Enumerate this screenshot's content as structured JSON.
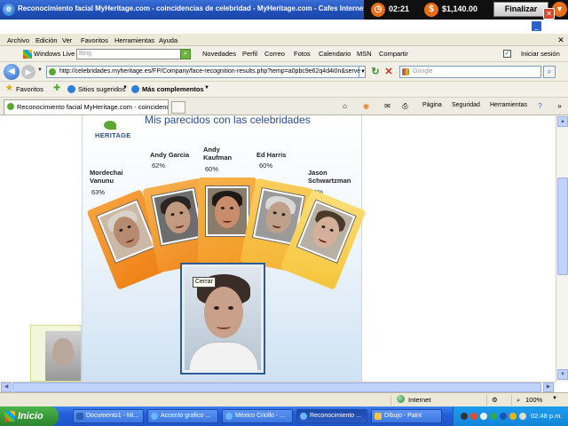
{
  "window": {
    "title": "Reconocimiento facial MyHeritage.com - coincidencias de celebridad - MyHeritage.com - Cafes Internet EL RETO tu mejor experienc"
  },
  "timer": {
    "time": "02:21",
    "money": "$1,140.00",
    "finalizar": "Finalizar"
  },
  "menu": [
    "Archivo",
    "Edición",
    "Ver",
    "Favoritos",
    "Herramientas",
    "Ayuda"
  ],
  "toolbar1": {
    "windows_live": "Windows Live",
    "bing_placeholder": "Bing",
    "items": [
      "Novedades",
      "Perfil",
      "Correo",
      "Fotos",
      "Calendario",
      "MSN",
      "Compartir"
    ],
    "signin": "Iniciar sesión"
  },
  "address": {
    "url": "http://celebridades.myheritage.es/FP/Company/face-recognition-results.php?temp=a0pbc9e62q4d4i0n&serve",
    "search_placeholder": "Google"
  },
  "favorites": {
    "favoritos": "Favoritos",
    "sugeridos": "Sitios sugeridos",
    "complementos": "Más complementos"
  },
  "tab": {
    "label": "Reconocimiento facial MyHeritage.com - coincidencias ...",
    "commands": [
      "Página",
      "Seguridad",
      "Herramientas"
    ]
  },
  "page": {
    "title": "Mis parecidos con las celebridades",
    "logo": "HERITAGE",
    "celebrities": [
      {
        "name": "Mordechai\nVanunu",
        "pct": "63%"
      },
      {
        "name": "Andy Garcia",
        "pct": "62%"
      },
      {
        "name": "Andy\nKaufman",
        "pct": "60%"
      },
      {
        "name": "Ed Harris",
        "pct": "60%"
      },
      {
        "name": "Jason\nSchwartzman",
        "pct": "59%"
      }
    ],
    "tooltip": "Cerrar"
  },
  "status": {
    "zone": "Internet",
    "zoom": "100%"
  },
  "taskbar": {
    "start": "Inicio",
    "tasks": [
      "Documento1 - Mi...",
      "Accento grafico ...",
      "México Criollo - ...",
      "Reconocimiento ...",
      "Dibujo - Paint"
    ],
    "clock": "02:48 p.m."
  },
  "colors": {
    "card_orange": "#f08a1e",
    "card_yellow": "#f6c43a",
    "title_blue": "#2a4f8a",
    "taskbar_blue": "#245edb"
  }
}
